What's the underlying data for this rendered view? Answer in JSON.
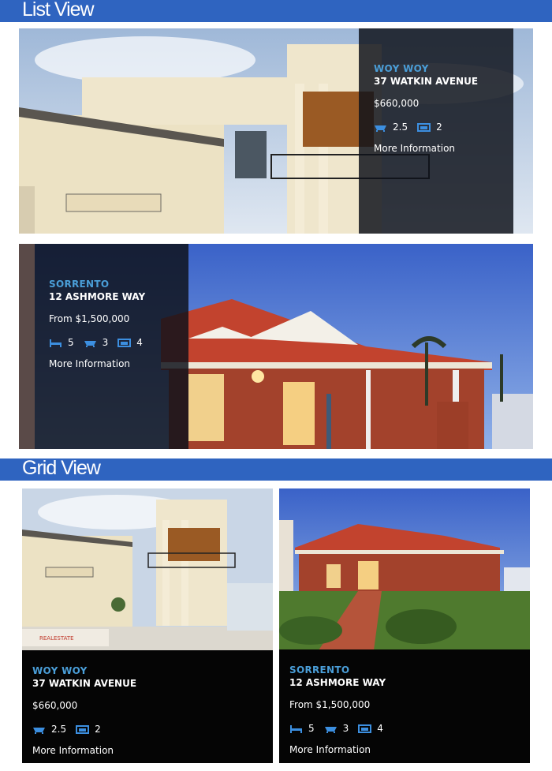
{
  "sections": {
    "list_title": "List View",
    "grid_title": "Grid View"
  },
  "listings": [
    {
      "suburb": "WOY WOY",
      "street": "37 WATKIN AVENUE",
      "price": "$660,000",
      "baths": "2.5",
      "cars": "2",
      "link": "More Information"
    },
    {
      "suburb": "SORRENTO",
      "street": "12 ASHMORE WAY",
      "price": "From $1,500,000",
      "beds": "5",
      "baths": "3",
      "cars": "4",
      "link": "More Information"
    }
  ],
  "grid_listings": [
    {
      "suburb": "WOY WOY",
      "street": "37 WATKIN AVENUE",
      "price": "$660,000",
      "baths": "2.5",
      "cars": "2",
      "link": "More Information",
      "watermark": "REALESTATE"
    },
    {
      "suburb": "SORRENTO",
      "street": "12 ASHMORE WAY",
      "price": "From $1,500,000",
      "beds": "5",
      "baths": "3",
      "cars": "4",
      "link": "More Information"
    }
  ],
  "colors": {
    "header_bar": "#2f64c0",
    "suburb_text": "#4a9ed8",
    "icon": "#3c8fe0",
    "overlay": "#0e121a"
  },
  "icons": {
    "bed": "bed-icon",
    "bath": "bath-icon",
    "car": "car-icon"
  }
}
